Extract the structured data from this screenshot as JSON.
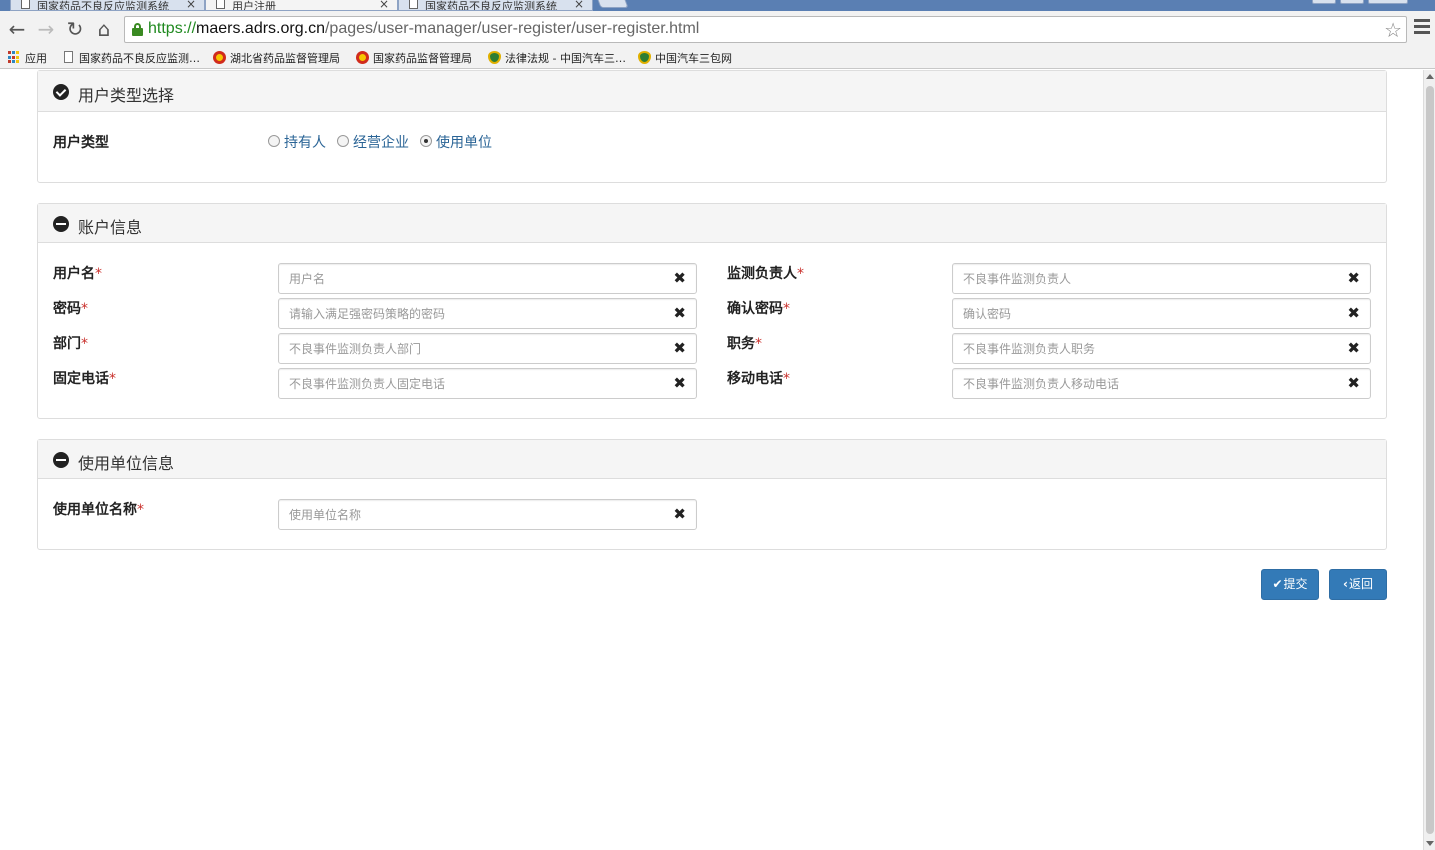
{
  "browser": {
    "tabs": [
      {
        "label": "国家药品不良反应监测系统"
      },
      {
        "label": "用户注册"
      },
      {
        "label": "国家药品不良反应监测系统"
      }
    ],
    "url": {
      "scheme": "https://",
      "host": "maers.adrs.org.cn",
      "path": "/pages/user-manager/user-register/user-register.html"
    },
    "bookmarks": [
      {
        "label": "应用",
        "icon": "apps-icon"
      },
      {
        "label": "国家药品不良反应监测…",
        "icon": "page-icon"
      },
      {
        "label": "湖北省药品监督管理局",
        "icon": "emblem-icon"
      },
      {
        "label": "国家药品监督管理局",
        "icon": "emblem-icon"
      },
      {
        "label": "法律法规 - 中国汽车三…",
        "icon": "shield-icon"
      },
      {
        "label": "中国汽车三包网",
        "icon": "shield-icon"
      }
    ]
  },
  "user_type_panel": {
    "title": "用户类型选择",
    "label": "用户类型",
    "options": [
      "持有人",
      "经营企业",
      "使用单位"
    ],
    "selected": "使用单位"
  },
  "account_panel": {
    "title": "账户信息",
    "required_mark": "*",
    "fields": {
      "username": {
        "label": "用户名",
        "placeholder": "用户名"
      },
      "monitor_lead": {
        "label": "监测负责人",
        "placeholder": "不良事件监测负责人"
      },
      "password": {
        "label": "密码",
        "placeholder": "请输入满足强密码策略的密码"
      },
      "confirm_password": {
        "label": "确认密码",
        "placeholder": "确认密码"
      },
      "department": {
        "label": "部门",
        "placeholder": "不良事件监测负责人部门"
      },
      "position": {
        "label": "职务",
        "placeholder": "不良事件监测负责人职务"
      },
      "phone": {
        "label": "固定电话",
        "placeholder": "不良事件监测负责人固定电话"
      },
      "mobile": {
        "label": "移动电话",
        "placeholder": "不良事件监测负责人移动电话"
      }
    }
  },
  "unit_panel": {
    "title": "使用单位信息",
    "required_mark": "*",
    "name_field": {
      "label": "使用单位名称",
      "placeholder": "使用单位名称"
    }
  },
  "actions": {
    "submit_label": "提交",
    "back_label": "返回"
  },
  "icons": {
    "clear": "times-icon",
    "submit": "check-icon",
    "back": "chevron-left-icon"
  },
  "colors": {
    "primary": "#337ab7",
    "required": "#c9302c",
    "link": "#2a6496"
  }
}
